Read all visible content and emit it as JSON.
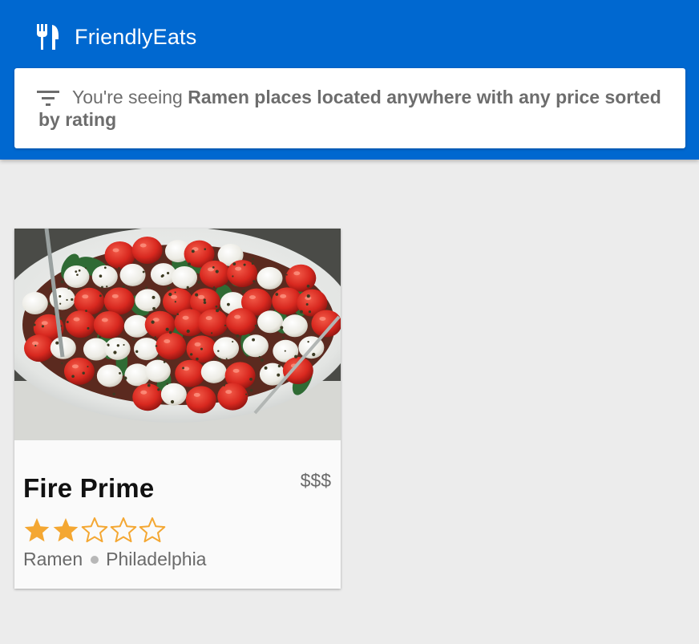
{
  "app": {
    "title": "FriendlyEats",
    "logo_icon": "fork-knife-icon",
    "header_color": "#0068d0"
  },
  "filter": {
    "icon": "filter-icon",
    "prefix": "You're seeing ",
    "description": "Ramen places located anywhere with any price sorted by rating"
  },
  "restaurants": [
    {
      "name": "Fire Prime",
      "price": "$$$",
      "rating": 2,
      "max_rating": 5,
      "category": "Ramen",
      "city": "Philadelphia",
      "image": "caprese-salad-bowl-photo",
      "star_color": "#f4a732"
    }
  ]
}
